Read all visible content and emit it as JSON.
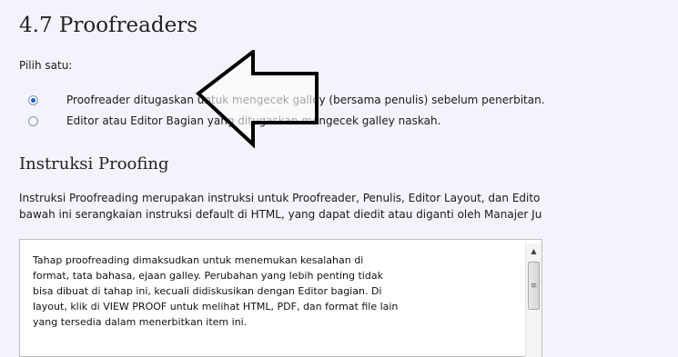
{
  "section": {
    "title": "4.7 Proofreaders",
    "choose_label": "Pilih satu:",
    "options": [
      {
        "label": "Proofreader ditugaskan untuk mengecek galley (bersama penulis) sebelum penerbitan.",
        "selected": true
      },
      {
        "label": "Editor atau Editor Bagian yang ditugaskan mengecek galley naskah.",
        "selected": false
      }
    ]
  },
  "instructions": {
    "title": "Instruksi Proofing",
    "description_line1": "Instruksi Proofreading merupakan instruksi untuk Proofreader, Penulis, Editor Layout, dan Edito",
    "description_line2": "bawah ini serangkaian instruksi default di HTML, yang dapat diedit atau diganti oleh Manajer Ju",
    "textarea_value": "Tahap proofreading dimaksudkan untuk menemukan kesalahan di\nformat, tata bahasa, ejaan galley. Perubahan yang lebih penting tidak\nbisa dibuat di tahap ini, kecuali didiskusikan dengan Editor bagian. Di\nlayout, klik di VIEW PROOF untuk melihat HTML, PDF, dan format file lain\nyang tersedia dalam menerbitkan item ini."
  },
  "annotation": {
    "icon": "left-arrow-icon",
    "color": "#000000"
  },
  "colors": {
    "background": "#f3f3fb",
    "radio_selected": "#1f5fc9"
  }
}
